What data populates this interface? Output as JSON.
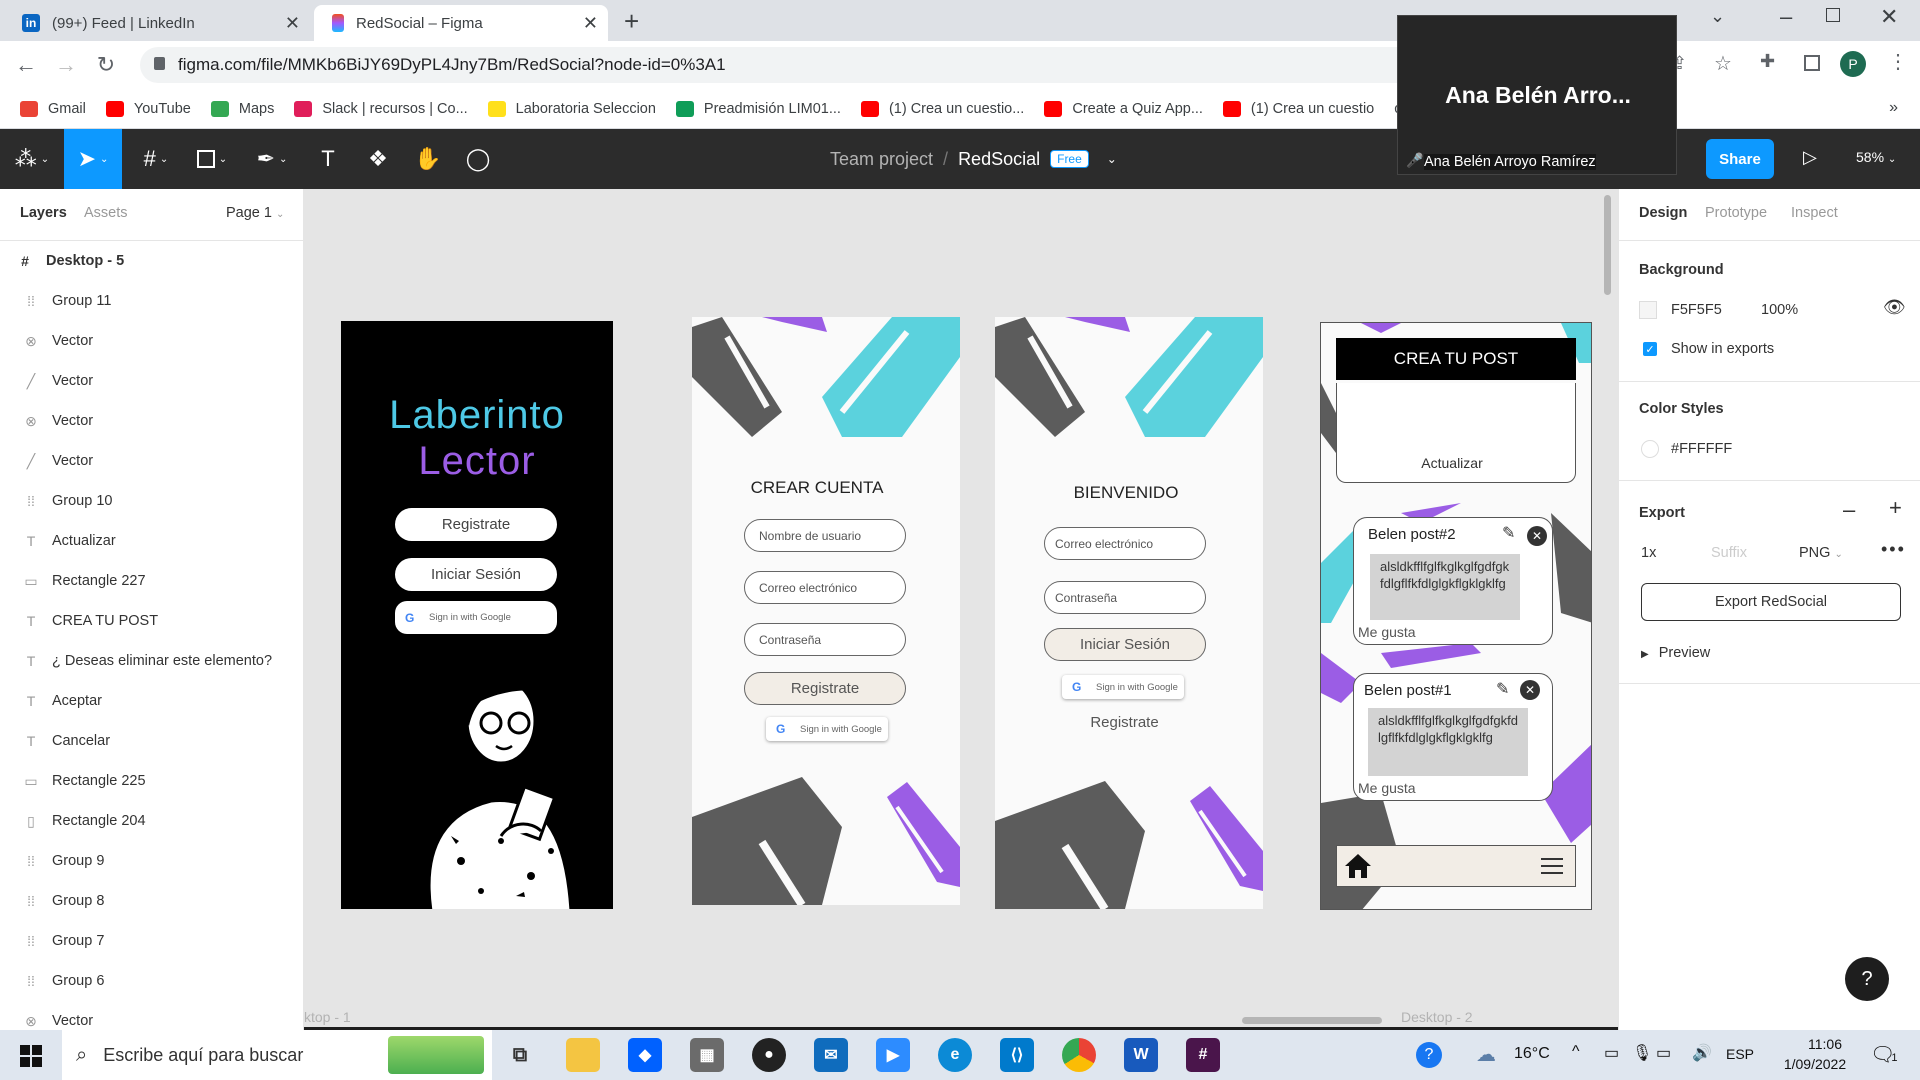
{
  "browser": {
    "tabs": [
      {
        "title": "(99+) Feed | LinkedIn",
        "favicon_color": "#0a66c2"
      },
      {
        "title": "RedSocial – Figma",
        "favicon_color": "#f24e1e"
      }
    ],
    "new_tab_icon": "plus-icon",
    "url": "figma.com/file/MMKb6BiJY69DyPL4Jny7Bm/RedSocial?node-id=0%3A1",
    "profile_initial": "P",
    "bookmarks": [
      {
        "label": "Gmail",
        "color": "#ea4335"
      },
      {
        "label": "YouTube",
        "color": "#ff0000"
      },
      {
        "label": "Maps",
        "color": "#34a853"
      },
      {
        "label": "Slack | recursos | Co...",
        "color": "#e01e5a"
      },
      {
        "label": "Laboratoria Seleccion",
        "color": "#ffe01b"
      },
      {
        "label": "Preadmisión LIM01...",
        "color": "#0f9d58"
      },
      {
        "label": "(1) Crea un cuestio...",
        "color": "#ff0000"
      },
      {
        "label": "Create a Quiz App...",
        "color": "#ff0000"
      },
      {
        "label": "(1) Crea un cuestio",
        "color": "#ff0000"
      },
      {
        "label": "cript: el valor d...",
        "color": ""
      }
    ]
  },
  "video_call": {
    "participant_big": "Ana Belén Arro...",
    "participant_full": "Ana Belén Arroyo Ramírez"
  },
  "figma": {
    "breadcrumb_team": "Team project",
    "file_name": "RedSocial",
    "plan_badge": "Free",
    "share_label": "Share",
    "zoom": "58%",
    "left_tabs": {
      "layers": "Layers",
      "assets": "Assets",
      "page": "Page 1"
    },
    "layers": [
      {
        "name": "Desktop - 5",
        "icon": "frame-icon"
      },
      {
        "name": "Group 11",
        "icon": "group-icon"
      },
      {
        "name": "Vector",
        "icon": "vector-icon"
      },
      {
        "name": "Vector",
        "icon": "line-icon"
      },
      {
        "name": "Vector",
        "icon": "vector-icon"
      },
      {
        "name": "Vector",
        "icon": "line-icon"
      },
      {
        "name": "Group 10",
        "icon": "group-icon"
      },
      {
        "name": "Actualizar",
        "icon": "text-icon"
      },
      {
        "name": "Rectangle 227",
        "icon": "rectangle-icon"
      },
      {
        "name": "CREA TU POST",
        "icon": "text-icon"
      },
      {
        "name": "¿ Deseas eliminar este elemento?",
        "icon": "text-icon"
      },
      {
        "name": "Aceptar",
        "icon": "text-icon"
      },
      {
        "name": "Cancelar",
        "icon": "text-icon"
      },
      {
        "name": "Rectangle 225",
        "icon": "rectangle-icon"
      },
      {
        "name": "Rectangle 204",
        "icon": "rectangle-icon"
      },
      {
        "name": "Group 9",
        "icon": "group-icon"
      },
      {
        "name": "Group 8",
        "icon": "group-icon"
      },
      {
        "name": "Group 7",
        "icon": "group-icon"
      },
      {
        "name": "Group 6",
        "icon": "group-icon"
      },
      {
        "name": "Vector",
        "icon": "vector-icon"
      }
    ],
    "right_tabs": {
      "design": "Design",
      "prototype": "Prototype",
      "inspect": "Inspect"
    },
    "background": {
      "title": "Background",
      "hex": "F5F5F5",
      "opacity": "100%",
      "show_in_exports": "Show in exports"
    },
    "color_styles": {
      "title": "Color Styles",
      "value": "#FFFFFF"
    },
    "export": {
      "title": "Export",
      "scale": "1x",
      "suffix_placeholder": "Suffix",
      "format": "PNG",
      "button": "Export RedSocial",
      "preview": "Preview"
    },
    "canvas_labels": {
      "left": "ktop - 1",
      "right": "Desktop - 2"
    },
    "help": "?"
  },
  "frames": {
    "f1": {
      "title_line1": "Laberinto",
      "title_line2": "Lector",
      "btn_register": "Registrate",
      "btn_login": "Iniciar Sesión",
      "google": "Sign in with Google"
    },
    "f2": {
      "heading": "CREAR CUENTA",
      "username_ph": "Nombre de usuario",
      "email_ph": "Correo electrónico",
      "password_ph": "Contraseña",
      "btn_register": "Registrate",
      "google": "Sign in with Google"
    },
    "f3": {
      "heading": "BIENVENIDO",
      "email_ph": "Correo electrónico",
      "password_ph": "Contraseña",
      "btn_login": "Iniciar Sesión",
      "google": "Sign in with Google",
      "link_register": "Registrate"
    },
    "f4": {
      "header": "CREA TU POST",
      "update": "Actualizar",
      "posts": [
        {
          "title": "Belen  post#2",
          "body": "alsldkfflfglfkglkglfgdfgkfdlgflfkfdlglgkflgklgklfg",
          "like": "Me gusta"
        },
        {
          "title": "Belen  post#1",
          "body": "alsldkfflfglfkglkglfgdfgkfdlgflfkfdlglgkflgklgklfg",
          "like": "Me gusta"
        }
      ]
    }
  },
  "taskbar": {
    "search_placeholder": "Escribe aquí para buscar",
    "temperature": "16°C",
    "language": "ESP",
    "time": "11:06",
    "date": "1/09/2022",
    "notification_count": "1"
  }
}
